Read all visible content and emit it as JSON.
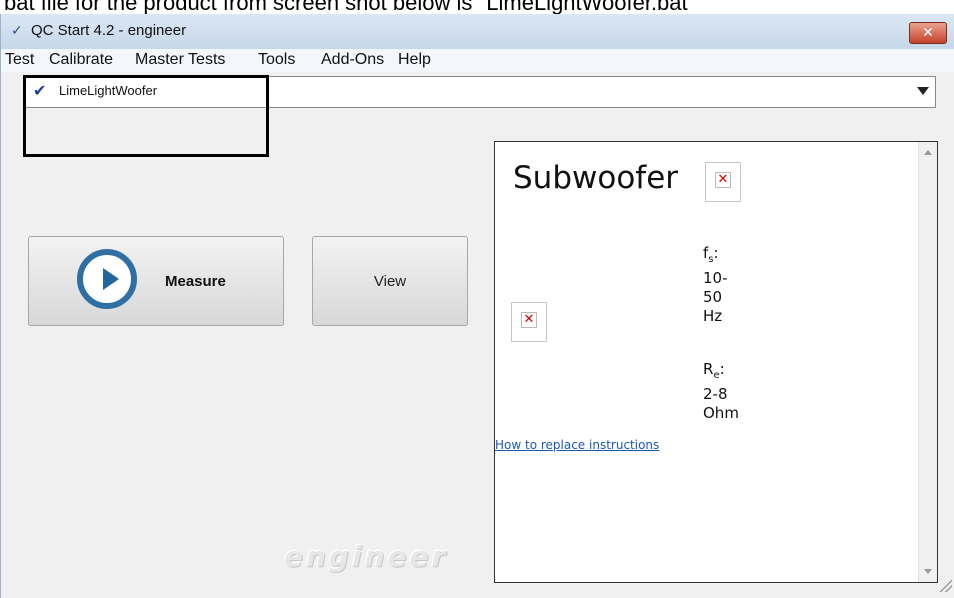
{
  "caption": "bat file for the product from screen shot below is \"LimeLightWoofer.bat\"",
  "window": {
    "title": "QC Start  4.2 - engineer",
    "close_glyph": "✕",
    "title_icon": "check-icon"
  },
  "menu": [
    "Test",
    "Calibrate",
    "Master Tests",
    "Tools",
    "Add-Ons",
    "Help"
  ],
  "product_select": {
    "value": "LimeLightWoofer",
    "check_glyph": "✔"
  },
  "buttons": {
    "measure": "Measure",
    "view": "View"
  },
  "watermark": "engineer",
  "panel": {
    "title": "Subwoofer",
    "broken_image_glyph": "✕",
    "fs": {
      "label": "f",
      "sub": "s",
      "colon": ":",
      "lines": [
        "10-",
        "50",
        "Hz"
      ]
    },
    "re": {
      "label": "R",
      "sub": "e",
      "colon": ":",
      "lines": [
        "2-8",
        "Ohm"
      ]
    },
    "link": "How to replace instructions"
  },
  "colors": {
    "accent": "#2f6fa3",
    "close": "#c5412a",
    "link": "#1d57b3"
  }
}
